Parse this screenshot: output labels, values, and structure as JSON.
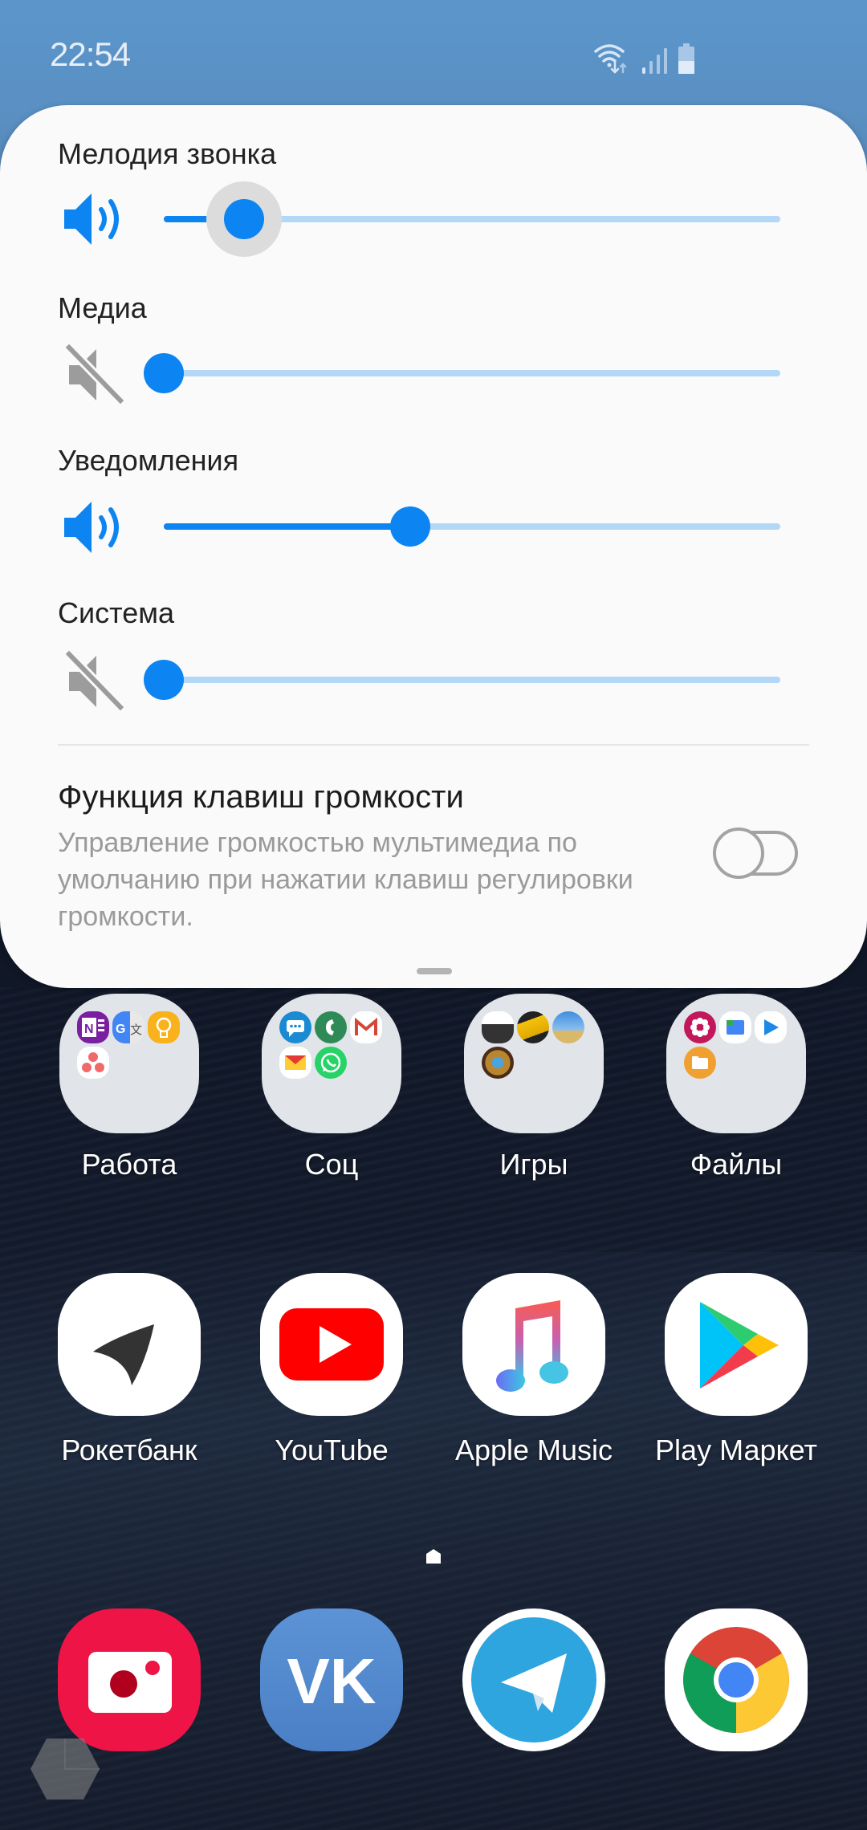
{
  "status_bar": {
    "time": "22:54",
    "icons": [
      "wifi-icon",
      "signal-icon",
      "battery-icon"
    ]
  },
  "volume_panel": {
    "accent_color": "#0c84f2",
    "sliders": [
      {
        "label": "Мелодия звонка",
        "icon": "speaker-on-icon",
        "level": 0.13,
        "active": true
      },
      {
        "label": "Медиа",
        "icon": "speaker-muted-icon",
        "level": 0.0,
        "active": false
      },
      {
        "label": "Уведомления",
        "icon": "speaker-on-icon",
        "level": 0.4,
        "active": false
      },
      {
        "label": "Система",
        "icon": "speaker-muted-icon",
        "level": 0.0,
        "active": false
      }
    ],
    "volume_keys": {
      "title": "Функция клавиш громкости",
      "description": "Управление громкостью мультимедиа по умолчанию при нажатии клавиш регулировки громкости.",
      "enabled": false
    }
  },
  "home": {
    "folders": [
      {
        "label": "Работа",
        "apps": [
          "OneNote",
          "Google Translate",
          "Google Keep",
          "Asana"
        ]
      },
      {
        "label": "Соц",
        "apps": [
          "Messages",
          "Phone",
          "Gmail",
          "Yandex Mail",
          "WhatsApp"
        ]
      },
      {
        "label": "Игры",
        "apps": [
          "Asphalt 9",
          "CarX Drift Racing",
          "PUBG Mobile",
          "Hearthstone"
        ]
      },
      {
        "label": "Файлы",
        "apps": [
          "Gallery",
          "Files by Google",
          "Play Movies",
          "My Files"
        ]
      }
    ],
    "apps": [
      {
        "label": "Рокетбанк",
        "icon": "rocketbank-icon"
      },
      {
        "label": "YouTube",
        "icon": "youtube-icon"
      },
      {
        "label": "Apple Music",
        "icon": "apple-music-icon"
      },
      {
        "label": "Play Маркет",
        "icon": "play-store-icon"
      }
    ],
    "dock": [
      {
        "name": "camera",
        "icon": "camera-icon"
      },
      {
        "name": "vk",
        "icon": "vk-icon"
      },
      {
        "name": "telegram",
        "icon": "telegram-icon"
      },
      {
        "name": "chrome",
        "icon": "chrome-icon"
      }
    ]
  }
}
